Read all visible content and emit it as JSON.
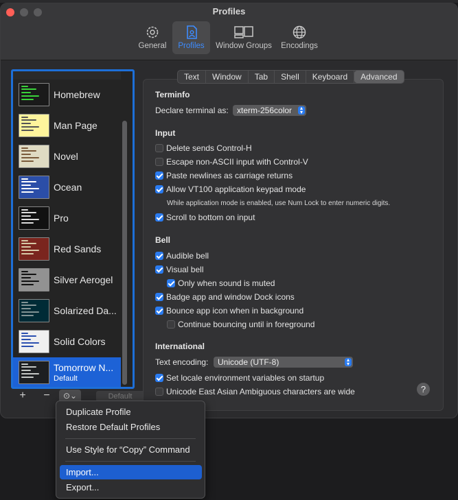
{
  "window": {
    "title": "Profiles"
  },
  "toolbar": [
    {
      "label": "General",
      "icon": "gear-icon"
    },
    {
      "label": "Profiles",
      "icon": "profile-doc-icon",
      "selected": true
    },
    {
      "label": "Window Groups",
      "icon": "window-groups-icon"
    },
    {
      "label": "Encodings",
      "icon": "globe-icon"
    }
  ],
  "profiles": [
    {
      "name": "Homebrew",
      "bg": "#1a1a1a",
      "fg": "#3ad33a"
    },
    {
      "name": "Man Page",
      "bg": "#fef49c",
      "fg": "#555555"
    },
    {
      "name": "Novel",
      "bg": "#dfdbc3",
      "fg": "#7a5a3a"
    },
    {
      "name": "Ocean",
      "bg": "#2b4ea8",
      "fg": "#ffffff"
    },
    {
      "name": "Pro",
      "bg": "#111111",
      "fg": "#dddddd"
    },
    {
      "name": "Red Sands",
      "bg": "#7a251e",
      "fg": "#d7c9a7"
    },
    {
      "name": "Silver Aerogel",
      "bg": "#929292",
      "fg": "#111111"
    },
    {
      "name": "Solarized Da...",
      "bg": "#002b36",
      "fg": "#839496"
    },
    {
      "name": "Solid Colors",
      "bg": "#f0f0f0",
      "fg": "#2a4fb0"
    },
    {
      "name": "Tomorrow N...",
      "default_label": "Default",
      "bg": "#1d1f21",
      "fg": "#c5c8c6",
      "selected": true
    }
  ],
  "list_buttons": {
    "add": "+",
    "remove": "−",
    "actions": "⊙⌄",
    "default": "Default"
  },
  "tabs": [
    "Text",
    "Window",
    "Tab",
    "Shell",
    "Keyboard",
    "Advanced"
  ],
  "selected_tab": "Advanced",
  "terminfo": {
    "heading": "Terminfo",
    "declare_label": "Declare terminal as:",
    "declare_value": "xterm-256color"
  },
  "input": {
    "heading": "Input",
    "delete_sends": {
      "label": "Delete sends Control-H",
      "checked": false
    },
    "escape_non_ascii": {
      "label": "Escape non-ASCII input with Control-V",
      "checked": false
    },
    "paste_newlines": {
      "label": "Paste newlines as carriage returns",
      "checked": true
    },
    "vt100_keypad": {
      "label": "Allow VT100 application keypad mode",
      "checked": true
    },
    "vt100_note": "While application mode is enabled, use Num Lock to enter numeric digits.",
    "scroll_bottom": {
      "label": "Scroll to bottom on input",
      "checked": true
    }
  },
  "bell": {
    "heading": "Bell",
    "audible": {
      "label": "Audible bell",
      "checked": true
    },
    "visual": {
      "label": "Visual bell",
      "checked": true
    },
    "only_muted": {
      "label": "Only when sound is muted",
      "checked": true
    },
    "badge": {
      "label": "Badge app and window Dock icons",
      "checked": true
    },
    "bounce": {
      "label": "Bounce app icon when in background",
      "checked": true
    },
    "continue_bounce": {
      "label": "Continue bouncing until in foreground",
      "checked": false
    }
  },
  "international": {
    "heading": "International",
    "encoding_label": "Text encoding:",
    "encoding_value": "Unicode (UTF-8)",
    "locale_env": {
      "label": "Set locale environment variables on startup",
      "checked": true
    },
    "east_asian": {
      "label": "Unicode East Asian Ambiguous characters are wide",
      "checked": false
    }
  },
  "help_label": "?",
  "menu": {
    "items": [
      "Duplicate Profile",
      "Restore Default Profiles",
      "Use Style for “Copy” Command",
      "Import...",
      "Export..."
    ],
    "highlighted": "Import..."
  }
}
